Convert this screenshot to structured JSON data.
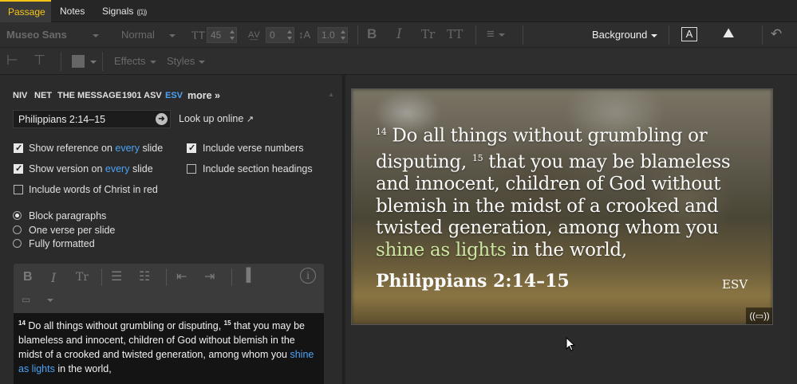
{
  "tabs": [
    {
      "label": "Passage",
      "active": true
    },
    {
      "label": "Notes",
      "active": false
    },
    {
      "label": "Signals",
      "active": false,
      "badge": "((1))"
    }
  ],
  "toolbar1": {
    "font_family": "Museo Sans",
    "font_weight": "Normal",
    "font_size": "45",
    "letter_spacing": "0",
    "line_height": "1.0",
    "background_label": "Background"
  },
  "toolbar2": {
    "effects_label": "Effects",
    "styles_label": "Styles"
  },
  "versions": [
    "NIV",
    "NET",
    "THE MESSAGE",
    "1901 ASV",
    "ESV",
    "more »"
  ],
  "active_version": "ESV",
  "passage_input": "Philippians 2:14–15",
  "lookup_label": "Look up online",
  "options": {
    "show_ref_prefix": "Show reference on ",
    "show_ref_every": "every",
    "show_ref_suffix": " slide",
    "show_ver_prefix": "Show version on ",
    "show_ver_every": "every",
    "show_ver_suffix": " slide",
    "words_of_christ": "Include words of Christ in red",
    "verse_numbers": "Include verse numbers",
    "section_headings": "Include section headings"
  },
  "layout_options": [
    "Block paragraphs",
    "One verse per slide",
    "Fully formatted"
  ],
  "editor": {
    "v14_num": "14",
    "v14_text": " Do all things without grumbling or disputing, ",
    "v15_num": "15",
    "v15_text": " that you may be blameless and innocent, children of God without blemish in the midst of a crooked and twisted generation, among whom you ",
    "highlight": "shine as lights",
    "tail": " in the world,"
  },
  "slide": {
    "v14_num": "14",
    "v14_text": " Do all things without grumbling or disputing, ",
    "v15_num": "15",
    "v15_text": " that you may be blameless and innocent, children of God without blemish in the midst of a crooked and twisted generation, among whom you ",
    "highlight": "shine as lights",
    "tail": " in the world,",
    "reference": "Philippians 2:14–15",
    "version": "ESV",
    "badge": "((▭))"
  },
  "colors": {
    "accent_tab": "#f5c518",
    "link_blue": "#4ba3f5",
    "highlight_green": "#cde7a3"
  }
}
